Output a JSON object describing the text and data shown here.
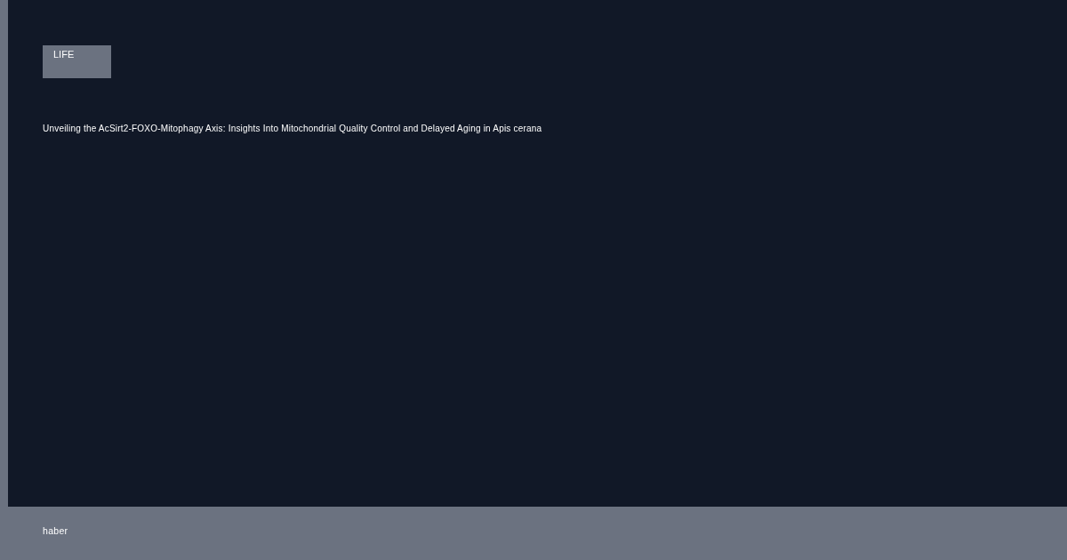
{
  "category_tag": "LIFE",
  "article": {
    "title": "Unveiling the AcSirt2‐FOXO‐Mitophagy Axis: Insights Into Mitochondrial Quality Control and Delayed Aging in Apis cerana"
  },
  "footer": {
    "text": "haber"
  }
}
